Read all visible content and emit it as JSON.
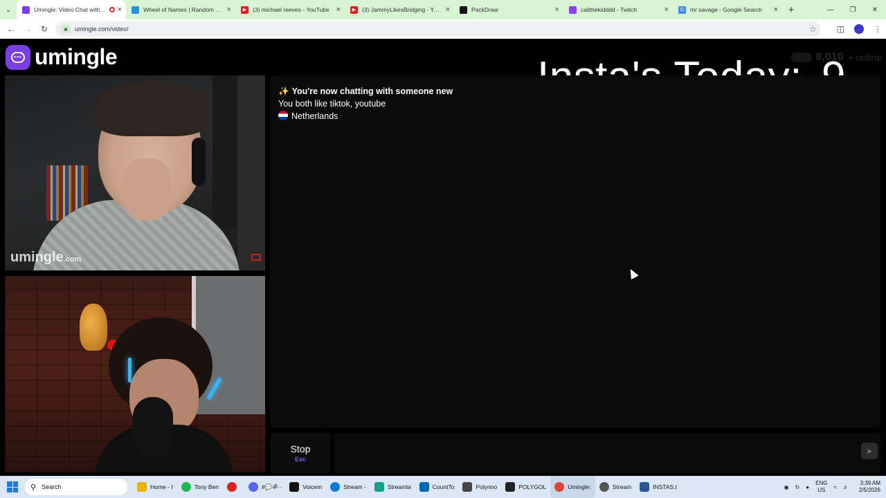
{
  "browser": {
    "tabs": [
      {
        "title": "Umingle: Video Chat with St",
        "active": true,
        "fav_color": "#7a3fe0",
        "recording": true
      },
      {
        "title": "Wheel of Names | Random nam",
        "fav_color": "#2a8fd8"
      },
      {
        "title": "(3) michael reeves - YouTube",
        "fav_color": "#e02020"
      },
      {
        "title": "(3) JammyLikesBridging - YouT",
        "fav_color": "#e02020"
      },
      {
        "title": "PackDraw",
        "fav_color": "#111111"
      },
      {
        "title": "calithekidddd - Twitch",
        "fav_color": "#8a43f0"
      },
      {
        "title": "mr savage - Google Search",
        "fav_color": "#4285f4"
      }
    ],
    "new_tab": "+",
    "url": "umingle.com/video/"
  },
  "site": {
    "logo_text": "umingle",
    "online_count": "8,010",
    "online_suffix": "+ online"
  },
  "overlay": {
    "label": "Insta's Today:",
    "value": "9"
  },
  "video": {
    "watermark_main": "umingle",
    "watermark_suffix": ".com"
  },
  "chat": {
    "header": "You're now chatting with someone new",
    "interests": "You both like tiktok, youtube",
    "country": "Netherlands"
  },
  "controls": {
    "stop_label": "Stop",
    "stop_key": "Esc",
    "message_placeholder": ""
  },
  "taskbar": {
    "search_label": "Search",
    "items": [
      {
        "label": "Home - I",
        "color": "#e8b400"
      },
      {
        "label": "Tony Ben",
        "color": "#1db954"
      },
      {
        "label": "",
        "color": "#e02020"
      },
      {
        "label": "#💬ॐ ·",
        "color": "#5865f2"
      },
      {
        "label": "Voicem",
        "color": "#111111"
      },
      {
        "label": "Stream -",
        "color": "#0b7ad6"
      },
      {
        "label": "Streamla",
        "color": "#16a085"
      },
      {
        "label": "CountTo",
        "color": "#0066b8"
      },
      {
        "label": "Polyrino",
        "color": "#444444"
      },
      {
        "label": "POLYGOL",
        "color": "#222222"
      },
      {
        "label": "Umingle:",
        "color": "#db4437",
        "active": true
      },
      {
        "label": "Stream",
        "color": "#555555"
      },
      {
        "label": "INSTAS.t",
        "color": "#2b579a"
      }
    ],
    "tray": {
      "lang_top": "ENG",
      "lang_bottom": "US",
      "time": "3:39 AM",
      "date": "2/5/2026"
    }
  }
}
